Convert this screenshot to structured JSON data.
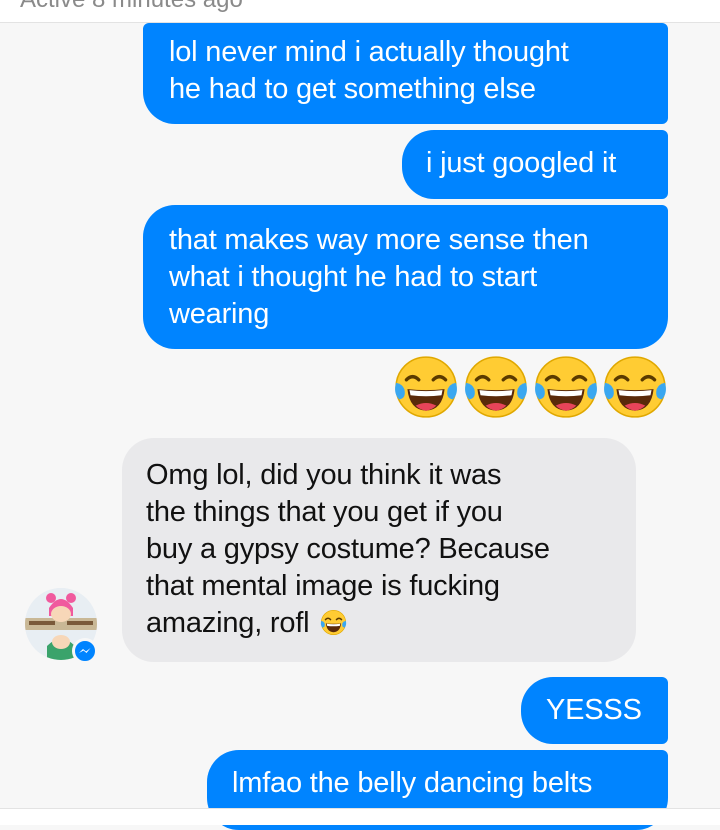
{
  "header": {
    "status_text": "Active 8 minutes ago"
  },
  "messages": [
    {
      "sender": "me",
      "lines": [
        "lol never mind i actually thought",
        "he had to get something else"
      ]
    },
    {
      "sender": "me",
      "lines": [
        "i just googled it"
      ]
    },
    {
      "sender": "me",
      "lines": [
        "that makes way more sense then",
        "what i thought he had to start",
        "wearing"
      ]
    },
    {
      "sender": "me",
      "emoji": "face-with-tears-of-joy",
      "emoji_count": 4
    },
    {
      "sender": "them",
      "lines": [
        "Omg lol, did you think it was",
        "the things that you get if you",
        "buy a gypsy costume? Because",
        "that mental image is fucking",
        "amazing, rofl"
      ],
      "trailing_emoji": "face-with-tears-of-joy"
    },
    {
      "sender": "me",
      "lines": [
        "YESSS"
      ]
    },
    {
      "sender": "me",
      "lines": [
        "lmfao the belly dancing belts"
      ]
    }
  ],
  "colors": {
    "outgoing_bubble": "#0084ff",
    "incoming_bubble": "#e9e9eb",
    "background": "#f7f7f7"
  }
}
